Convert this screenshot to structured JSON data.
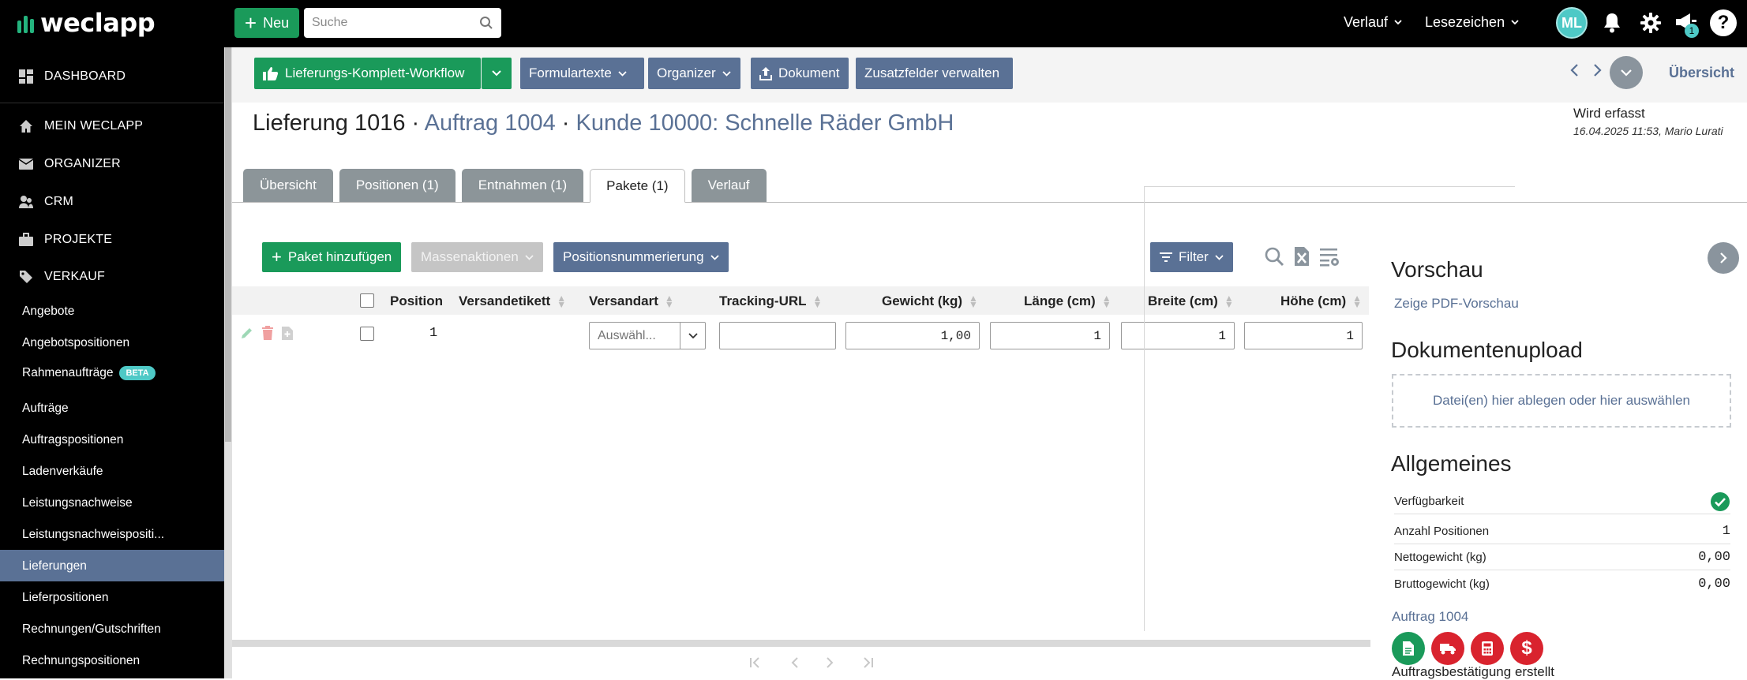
{
  "topbar": {
    "logo": "weclapp",
    "new_label": "Neu",
    "search_placeholder": "Suche",
    "verlauf": "Verlauf",
    "lesezeichen": "Lesezeichen",
    "avatar": "ML",
    "notification_count": "1",
    "help": "?"
  },
  "sidebar": {
    "main": [
      "DASHBOARD",
      "MEIN WECLAPP",
      "ORGANIZER",
      "CRM",
      "PROJEKTE",
      "VERKAUF"
    ],
    "sub": [
      "Angebote",
      "Angebotspositionen",
      "Rahmenaufträge",
      "Aufträge",
      "Auftragspositionen",
      "Ladenverkäufe",
      "Leistungsnachweise",
      "Leistungsnachweispositi...",
      "Lieferungen",
      "Lieferpositionen",
      "Rechnungen/Gutschriften",
      "Rechnungspositionen"
    ],
    "beta": "BETA"
  },
  "actions": {
    "workflow": "Lieferungs-Komplett-Workflow",
    "formulartexte": "Formulartexte",
    "organizer": "Organizer",
    "dokument": "Dokument",
    "zusatzfelder": "Zusatzfelder verwalten",
    "uebersicht": "Übersicht"
  },
  "header": {
    "title": "Lieferung 1016",
    "sep1": " · ",
    "auftrag": "Auftrag 1004",
    "sep2": " · ",
    "kunde": "Kunde 10000: Schnelle Räder GmbH",
    "status": "Wird erfasst",
    "status_meta": "16.04.2025 11:53, Mario Lurati"
  },
  "tabs": [
    "Übersicht",
    "Positionen (1)",
    "Entnahmen (1)",
    "Pakete (1)",
    "Verlauf"
  ],
  "toolbar": {
    "add": "Paket hinzufügen",
    "mass": "Massenaktionen",
    "numbering": "Positionsnummerierung",
    "filter": "Filter"
  },
  "table": {
    "columns": [
      "Position",
      "Versandetikett",
      "Versandart",
      "Tracking-URL",
      "Gewicht (kg)",
      "Länge (cm)",
      "Breite (cm)",
      "Höhe (cm)"
    ],
    "row": {
      "position": "1",
      "versandart_placeholder": "Auswähl...",
      "tracking": "",
      "gewicht": "1,00",
      "laenge": "1",
      "breite": "1",
      "hoehe": "1"
    }
  },
  "panel": {
    "vorschau": "Vorschau",
    "pdf_link": "Zeige PDF-Vorschau",
    "upload_title": "Dokumentenupload",
    "dropzone": "Datei(en) hier ablegen oder hier auswählen",
    "allgemeines": "Allgemeines",
    "rows": [
      {
        "label": "Verfügbarkeit",
        "value": ""
      },
      {
        "label": "Anzahl Positionen",
        "value": "1"
      },
      {
        "label": "Nettogewicht (kg)",
        "value": "0,00"
      },
      {
        "label": "Bruttogewicht (kg)",
        "value": "0,00"
      }
    ],
    "auftrag_link": "Auftrag 1004",
    "bottom_text": "Auftragsbestätigung erstellt"
  },
  "colors": {
    "green": "#1a9a5a",
    "blue": "#5a7195",
    "teal": "#4ec9c6",
    "red": "#d9232e"
  }
}
